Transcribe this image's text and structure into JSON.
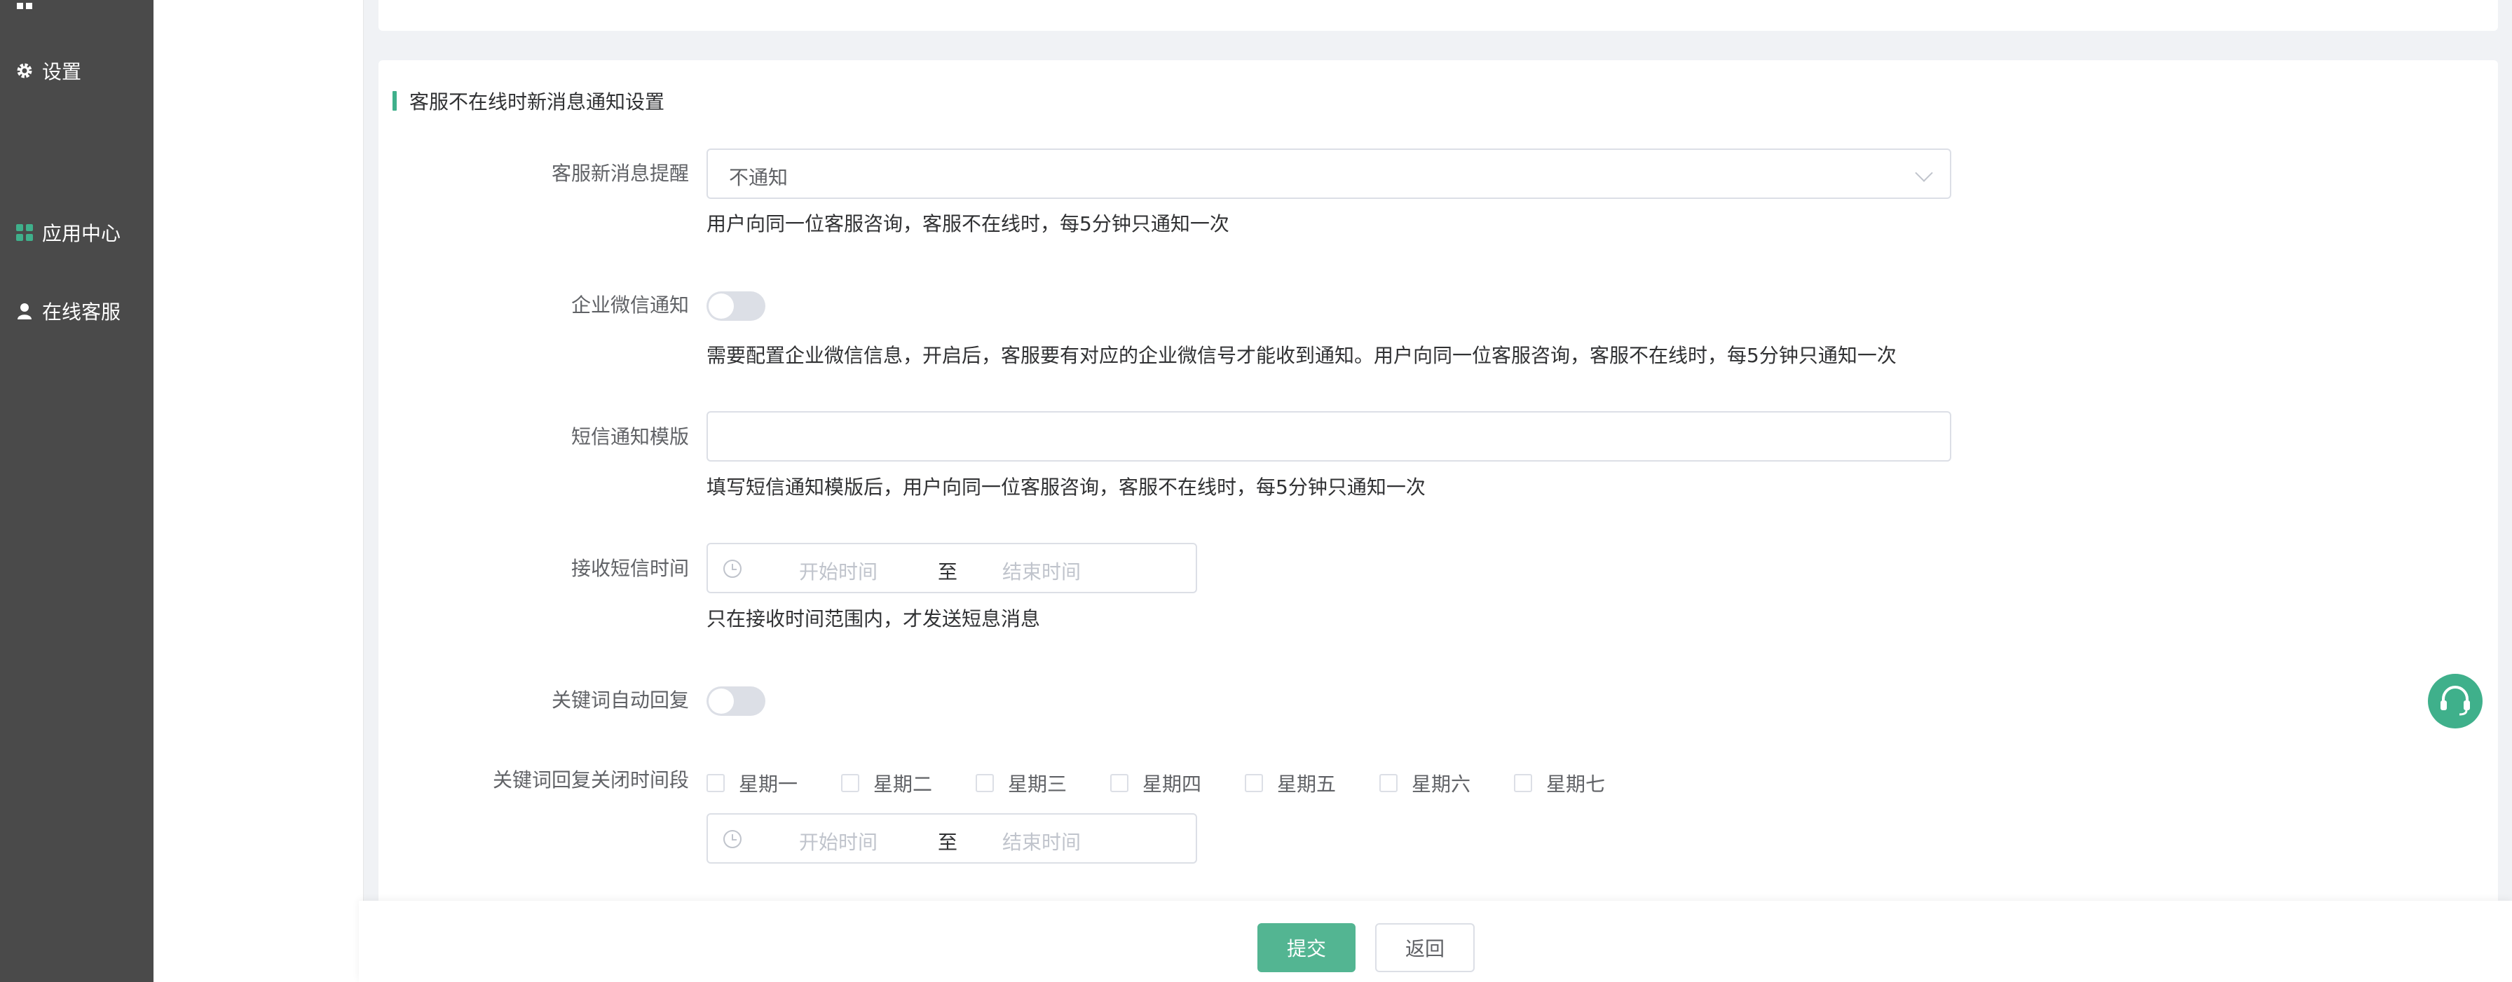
{
  "sidebar": {
    "items": [
      {
        "label": "设置",
        "icon": "gear-icon"
      },
      {
        "label": "应用中心",
        "icon": "apps-grid-icon"
      },
      {
        "label": "在线客服",
        "icon": "user-icon"
      }
    ]
  },
  "section": {
    "title": "客服不在线时新消息通知设置"
  },
  "form": {
    "new_msg_reminder": {
      "label": "客服新消息提醒",
      "value": "不通知",
      "help": "用户向同一位客服咨询，客服不在线时，每5分钟只通知一次"
    },
    "wecom_notify": {
      "label": "企业微信通知",
      "enabled": false,
      "help": "需要配置企业微信信息，开启后，客服要有对应的企业微信号才能收到通知。用户向同一位客服咨询，客服不在线时，每5分钟只通知一次"
    },
    "sms_template": {
      "label": "短信通知模版",
      "value": "",
      "help": "填写短信通知模版后，用户向同一位客服咨询，客服不在线时，每5分钟只通知一次"
    },
    "sms_time": {
      "label": "接收短信时间",
      "start_placeholder": "开始时间",
      "separator": "至",
      "end_placeholder": "结束时间",
      "help": "只在接收时间范围内，才发送短息消息"
    },
    "keyword_reply": {
      "label": "关键词自动回复",
      "enabled": false
    },
    "keyword_off_period": {
      "label": "关键词回复关闭时间段",
      "weekdays": [
        "星期一",
        "星期二",
        "星期三",
        "星期四",
        "星期五",
        "星期六",
        "星期七"
      ],
      "start_placeholder": "开始时间",
      "separator": "至",
      "end_placeholder": "结束时间"
    }
  },
  "actions": {
    "submit": "提交",
    "back": "返回"
  },
  "colors": {
    "accent": "#53b592",
    "sidebar_bg": "#4a4a4a"
  }
}
